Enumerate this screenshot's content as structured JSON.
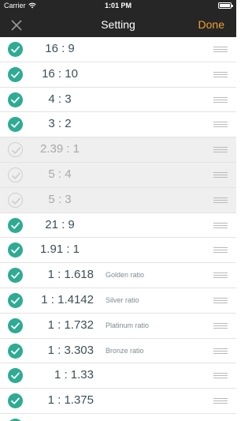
{
  "status_bar": {
    "carrier": "Carrier",
    "time": "1:01 PM",
    "wifi_icon": "wifi-icon",
    "battery_icon": "battery-icon"
  },
  "nav": {
    "title": "Setting",
    "done_label": "Done",
    "close_icon": "close-icon"
  },
  "colors": {
    "accent": "#f0a030",
    "check": "#2eab93",
    "header": "#262626"
  },
  "rows": [
    {
      "ratio": "16 : 9",
      "desc": "",
      "enabled": true
    },
    {
      "ratio": "16 : 10",
      "desc": "",
      "enabled": true
    },
    {
      "ratio": "4 : 3",
      "desc": "",
      "enabled": true
    },
    {
      "ratio": "3 : 2",
      "desc": "",
      "enabled": true
    },
    {
      "ratio": "2.39 : 1",
      "desc": "",
      "enabled": false
    },
    {
      "ratio": "5 : 4",
      "desc": "",
      "enabled": false
    },
    {
      "ratio": "5 : 3",
      "desc": "",
      "enabled": false
    },
    {
      "ratio": "21 : 9",
      "desc": "",
      "enabled": true
    },
    {
      "ratio": "1.91 : 1",
      "desc": "",
      "enabled": true
    },
    {
      "ratio": "1 : 1.618",
      "desc": "Golden ratio",
      "enabled": true
    },
    {
      "ratio": "1 : 1.4142",
      "desc": "Silver ratio",
      "enabled": true
    },
    {
      "ratio": "1 : 1.732",
      "desc": "Platinum ratio",
      "enabled": true
    },
    {
      "ratio": "1 : 3.303",
      "desc": "Bronze ratio",
      "enabled": true
    },
    {
      "ratio": "1 : 1.33",
      "desc": "",
      "enabled": true
    },
    {
      "ratio": "1 : 1.375",
      "desc": "",
      "enabled": true
    },
    {
      "ratio": "",
      "desc": "",
      "enabled": true
    }
  ]
}
